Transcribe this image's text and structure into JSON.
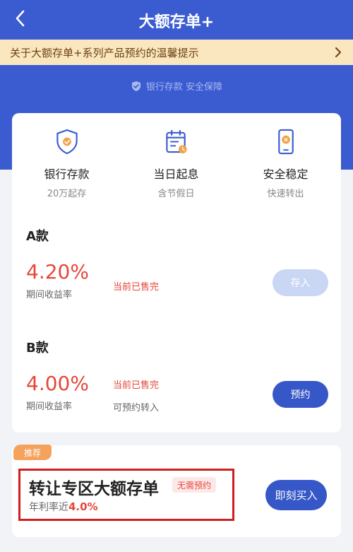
{
  "header": {
    "title": "大额存单+"
  },
  "notice": {
    "text": "关于大额存单+系列产品预约的温馨提示"
  },
  "assurance": {
    "text": "银行存款 安全保障"
  },
  "features": [
    {
      "title": "银行存款",
      "subtitle": "20万起存",
      "icon": "shield-icon"
    },
    {
      "title": "当日起息",
      "subtitle": "含节假日",
      "icon": "calendar-icon"
    },
    {
      "title": "安全稳定",
      "subtitle": "快速转出",
      "icon": "phone-icon"
    }
  ],
  "products": [
    {
      "name": "A款",
      "rate": "4.20%",
      "rate_label": "期间收益率",
      "status": "当前已售完",
      "note": "",
      "button": "存入",
      "button_enabled": false
    },
    {
      "name": "B款",
      "rate": "4.00%",
      "rate_label": "期间收益率",
      "status": "当前已售完",
      "note": "可预约转入",
      "button": "预约",
      "button_enabled": true
    }
  ],
  "recommend": {
    "badge": "推荐",
    "title": "转让专区大额存单",
    "tag": "无需预约",
    "subtitle_prefix": "年利率近",
    "rate": "4.0%",
    "button": "即刻买入"
  },
  "colors": {
    "brand": "#3b5bd1",
    "accent_red": "#e5473a",
    "disabled_button": "#c9d6f4",
    "notice_bg": "#fbe7bf"
  }
}
